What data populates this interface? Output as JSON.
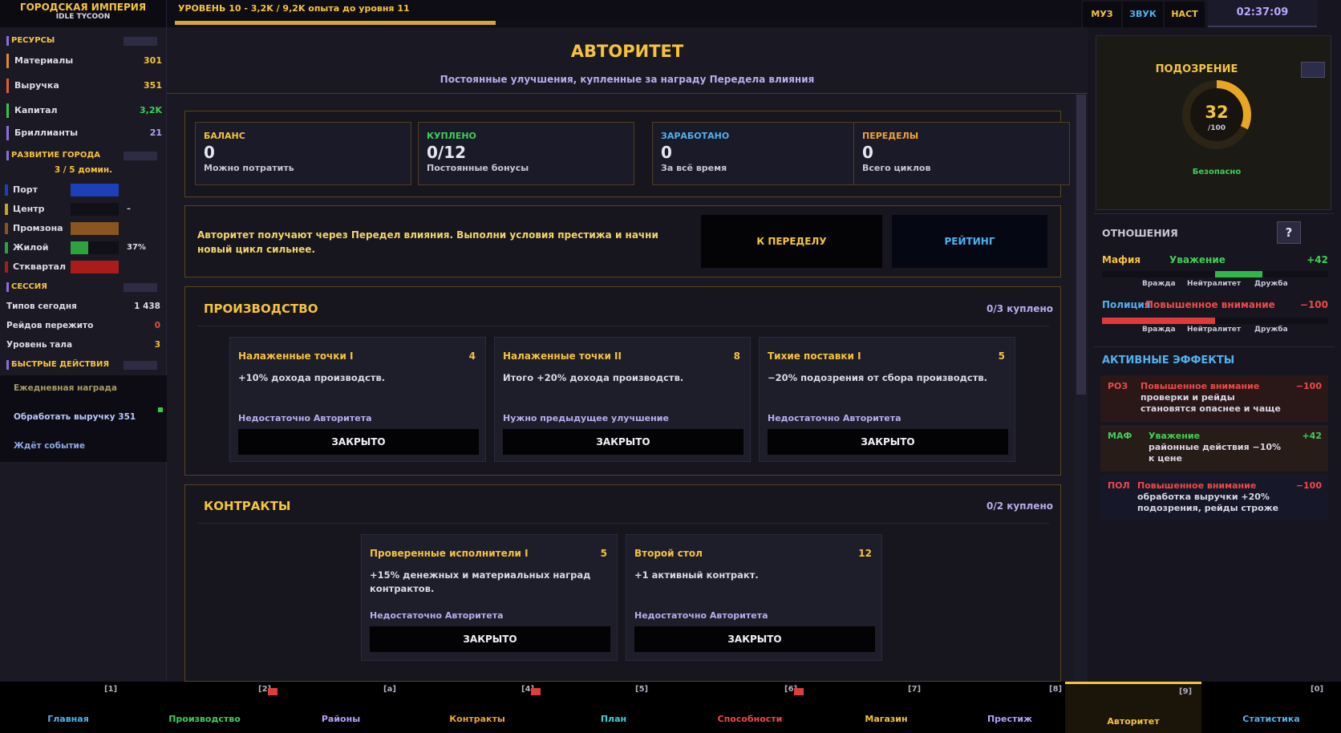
{
  "brand": {
    "title": "ГОРОДСКАЯ ИМПЕРИЯ",
    "subtitle": "IDLE TYCOON"
  },
  "top": {
    "level_text": "УРОВЕНЬ 10 - 3,2K / 9,2K опыта до уровня 11",
    "level_progress": 0.348,
    "music": "МУЗ",
    "sound": "ЗВУК",
    "settings": "НАСТ",
    "clock": "02:37:09"
  },
  "sidebar": {
    "resources_title": "РЕСУРСЫ",
    "resources": [
      {
        "label": "Материалы",
        "value": "301",
        "color": "#e08a2a"
      },
      {
        "label": "Выручка",
        "value": "351",
        "color": "#e0602a"
      },
      {
        "label": "Капитал",
        "value": "3,2K",
        "color": "#36c24a"
      },
      {
        "label": "Бриллианты",
        "value": "21",
        "color": "#8b6de0"
      }
    ],
    "city_title": "РАЗВИТИЕ ГОРОДА",
    "city_houses": "3 / 5 домин.",
    "districts": [
      {
        "label": "Порт",
        "pct": "",
        "color": "#1e3fb8",
        "level": 1.0
      },
      {
        "label": "Центр",
        "pct": "–",
        "color": "#c8a22a",
        "level": 0
      },
      {
        "label": "Промзона",
        "pct": "",
        "color": "#8a5520",
        "level": 1.0
      },
      {
        "label": "Жилой",
        "pct": "37%",
        "color": "#2fa23e",
        "level": 0.37
      },
      {
        "label": "Стквартал",
        "pct": "",
        "color": "#a81c1c",
        "level": 1.0
      }
    ],
    "session_title": "СЕССИЯ",
    "session": [
      {
        "label": "Типов сегодня",
        "value": "1 438",
        "color": "#dddbe7"
      },
      {
        "label": "Рейдов пережито",
        "value": "0",
        "color": "#e0504a"
      },
      {
        "label": "Уровень тала",
        "value": "3",
        "color": "#f5c33b"
      }
    ],
    "quick_title": "БЫСТРЫЕ ДЕЙСТВИЯ",
    "quick": [
      {
        "label": "Ежедневная награда",
        "color": "#a89a6a"
      },
      {
        "label": "Обработать выручку 351",
        "color": "#b8c8ff"
      },
      {
        "label": "Ждёт событие",
        "color": "#8fa6e8"
      }
    ]
  },
  "main": {
    "title": "АВТОРИТЕТ",
    "subtitle": "Постоянные улучшения, купленные за награду Передела влияния",
    "stats": [
      {
        "label": "БАЛАНС",
        "value": "0",
        "hint": "Можно потратить",
        "color": "#f5c33b"
      },
      {
        "label": "КУПЛЕНО",
        "value": "0/12",
        "hint": "Постоянные бонусы",
        "color": "#3ecf58"
      },
      {
        "label": "ЗАРАБОТАНО",
        "value": "0",
        "hint": "За всё время",
        "color": "#4fb1f0"
      },
      {
        "label": "ПЕРЕДЕЛЫ",
        "value": "0",
        "hint": "Всего циклов",
        "color": "#f0a23a"
      }
    ],
    "info": "Авторитет получают через Передел влияния. Выполни условия престижа и начни новый цикл сильнее.",
    "btn_prestige": "К ПЕРЕДЕЛУ",
    "btn_rating": "РЕЙТИНГ",
    "production": {
      "title": "ПРОИЗВОДСТВО",
      "count": "0/3 куплено",
      "cards": [
        {
          "title": "Налаженные точки I",
          "cost": "4",
          "desc": "+10% дохода производств.",
          "status": "Недостаточно Авторитета",
          "button": "ЗАКРЫТО"
        },
        {
          "title": "Налаженные точки II",
          "cost": "8",
          "desc": "Итого +20% дохода производств.",
          "status": "Нужно предыдущее улучшение",
          "button": "ЗАКРЫТО"
        },
        {
          "title": "Тихие поставки I",
          "cost": "5",
          "desc": "−20% подозрения от сбора производств.",
          "status": "Недостаточно Авторитета",
          "button": "ЗАКРЫТО"
        }
      ]
    },
    "contracts": {
      "title": "КОНТРАКТЫ",
      "count": "0/2 куплено",
      "cards": [
        {
          "title": "Проверенные исполнители I",
          "cost": "5",
          "desc": "+15% денежных и материальных наград контрактов.",
          "status": "Недостаточно Авторитета",
          "button": "ЗАКРЫТО"
        },
        {
          "title": "Второй стол",
          "cost": "12",
          "desc": "+1 активный контракт.",
          "status": "Недостаточно Авторитета",
          "button": "ЗАКРЫТО"
        }
      ]
    }
  },
  "right": {
    "suspicion_title": "ПОДОЗРЕНИЕ",
    "suspicion_value": "32",
    "suspicion_max": "/100",
    "suspicion_level": 0.32,
    "suspicion_status": "Безопасно",
    "relations_title": "ОТНОШЕНИЯ",
    "help": "?",
    "relations": [
      {
        "name": "Мафия",
        "state": "Уважение",
        "value": "+42",
        "color": "#f5c33b",
        "state_color": "#3ecf58",
        "value_color": "#3ecf58",
        "bar_color": "#2fb84a",
        "level": 42
      },
      {
        "name": "Полиция",
        "state": "Повышенное внимание",
        "value": "−100",
        "color": "#4fb1f0",
        "state_color": "#f04848",
        "value_color": "#f04848",
        "bar_color": "#e03a3a",
        "level": -100
      }
    ],
    "ticks": [
      "Вражда",
      "Нейтралитет",
      "Дружба"
    ],
    "effects_title": "АКТИВНЫЕ ЭФФЕКТЫ",
    "effects": [
      {
        "tag": "РОЗ",
        "name": "Повышенное внимание",
        "value": "−100",
        "desc_1": "проверки и рейды",
        "desc_2": "становятся опаснее и чаще",
        "tag_color": "#f04848",
        "name_color": "#f04848",
        "value_color": "#f04848",
        "bg": "#2a1718"
      },
      {
        "tag": "МАФ",
        "name": "Уважение",
        "value": "+42",
        "desc_1": "районные действия −10%",
        "desc_2": "к цене",
        "tag_color": "#3ecf58",
        "name_color": "#3ecf58",
        "value_color": "#3ecf58",
        "bg": "#281c18"
      },
      {
        "tag": "ПОЛ",
        "name": "Повышенное внимание",
        "value": "−100",
        "desc_1": "обработка выручки +20%",
        "desc_2": "подозрения, рейды строже",
        "tag_color": "#f04848",
        "name_color": "#f04848",
        "value_color": "#f04848",
        "bg": "#161829"
      }
    ]
  },
  "nav": [
    {
      "key": "[1]",
      "label": "Главная",
      "color": "#4fb1f0",
      "alert": false
    },
    {
      "key": "[2]",
      "label": "Производство",
      "color": "#3ecf58",
      "alert": true
    },
    {
      "key": "[a]",
      "label": "Районы",
      "color": "#b8a0ff",
      "alert": false
    },
    {
      "key": "[4]",
      "label": "Контракты",
      "color": "#f0a23a",
      "alert": true
    },
    {
      "key": "[5]",
      "label": "План",
      "color": "#3fd0d8",
      "alert": false
    },
    {
      "key": "[6]",
      "label": "Способности",
      "color": "#f04848",
      "alert": true
    },
    {
      "key": "[7]",
      "label": "Магазин",
      "color": "#f5c33b",
      "alert": false
    },
    {
      "key": "[8]",
      "label": "Престиж",
      "color": "#b8a0ff",
      "alert": false
    },
    {
      "key": "[9]",
      "label": "Авторитет",
      "color": "#f5c33b",
      "alert": false,
      "active": true
    },
    {
      "key": "[0]",
      "label": "Статистика",
      "color": "#4fb1f0",
      "alert": false
    }
  ]
}
